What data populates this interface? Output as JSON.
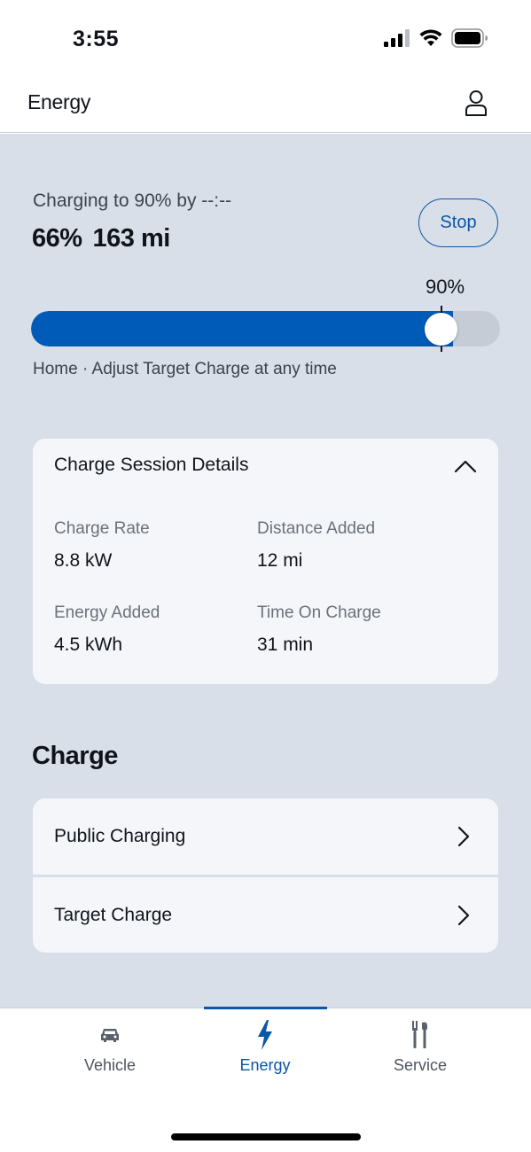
{
  "status_bar": {
    "time": "3:55"
  },
  "header": {
    "title": "Energy"
  },
  "charging": {
    "status_text": "Charging to 90% by --:--",
    "percent": "66%",
    "range": "163 mi",
    "stop_label": "Stop",
    "target_label": "90%",
    "current_fraction": 0.66,
    "target_fraction": 0.9,
    "hint": "Home · Adjust Target Charge at any time"
  },
  "session": {
    "title": "Charge Session Details",
    "metrics": [
      {
        "label": "Charge Rate",
        "value": "8.8 kW"
      },
      {
        "label": "Distance Added",
        "value": "12 mi"
      },
      {
        "label": "Energy Added",
        "value": "4.5 kWh"
      },
      {
        "label": "Time On Charge",
        "value": "31 min"
      }
    ]
  },
  "charge_section": {
    "title": "Charge",
    "items": [
      {
        "label": "Public Charging"
      },
      {
        "label": "Target Charge"
      }
    ]
  },
  "tabs": [
    {
      "label": "Vehicle",
      "icon": "car-icon",
      "active": false
    },
    {
      "label": "Energy",
      "icon": "lightning-icon",
      "active": true
    },
    {
      "label": "Service",
      "icon": "tools-icon",
      "active": false
    }
  ],
  "colors": {
    "accent": "#005bb8",
    "background": "#d8dfe9",
    "card": "#f4f6f9"
  }
}
